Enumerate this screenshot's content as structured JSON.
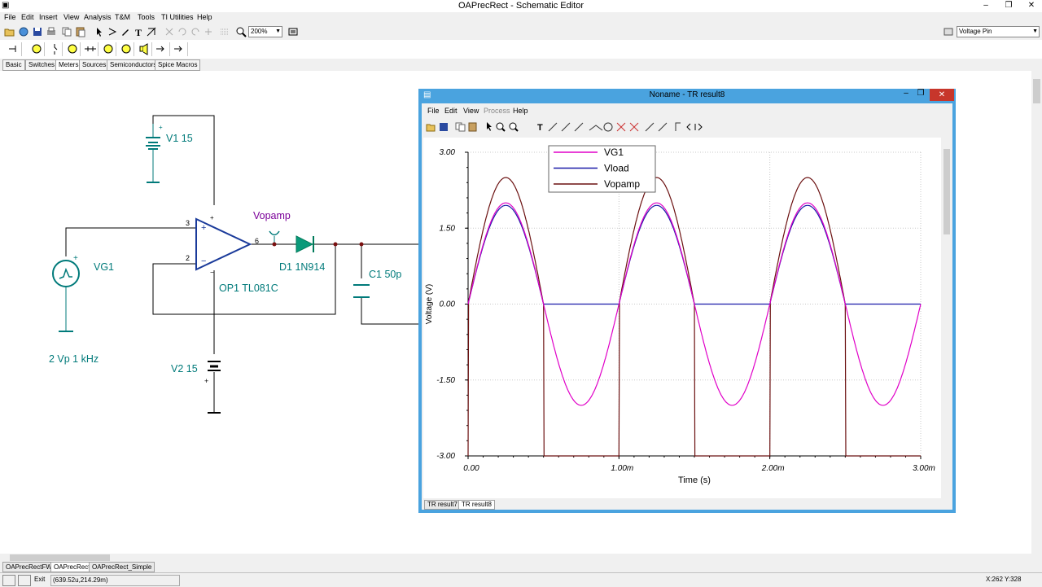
{
  "app": {
    "title": "OAPrecRect - Schematic Editor",
    "menu": [
      "File",
      "Edit",
      "Insert",
      "View",
      "Analysis",
      "T&M",
      "Tools",
      "TI Utilities",
      "Help"
    ],
    "zoom": "200%",
    "voltage_pin_select": "Voltage Pin",
    "component_tabs": [
      "Basic",
      "Switches",
      "Meters",
      "Sources",
      "Semiconductors",
      "Spice Macros"
    ],
    "doc_tabs": [
      "OAPrecRectFW",
      "OAPrecRect",
      "OAPrecRect_Simple"
    ],
    "status_exit": "Exit",
    "status_coords": "(639.52u,214.29m)",
    "status_xy": "X:262  Y:328",
    "toolbar_icons": [
      "open-icon",
      "save-icon",
      "print-icon",
      "copy-icon",
      "paste-icon",
      "pointer-icon",
      "wire-icon",
      "text-icon",
      "zoom-icon"
    ]
  },
  "schematic": {
    "v1_label": "V1 15",
    "v2_label": "V2 15",
    "vg1_label": "VG1",
    "vg1_value": "2 Vp 1 kHz",
    "vopamp_label": "Vopamp",
    "d1_label": "D1 1N914",
    "c1_label": "C1 50p",
    "op1_label": "OP1 TL081C",
    "pin3": "3",
    "pin2": "2",
    "pin6": "6"
  },
  "result_window": {
    "title": "Noname - TR result8",
    "menu": [
      "File",
      "Edit",
      "View",
      "Process",
      "Help"
    ],
    "tabs": [
      "TR result7",
      "TR result8"
    ],
    "active_tab": "TR result8"
  },
  "chart_data": {
    "type": "line",
    "xlabel": "Time (s)",
    "ylabel": "Voltage (V)",
    "xlim": [
      0,
      0.003
    ],
    "ylim": [
      -3,
      3
    ],
    "x_ticks": [
      "0.00",
      "1.00m",
      "2.00m",
      "3.00m"
    ],
    "y_ticks": [
      "3.00",
      "1.50",
      "0.00",
      "-1.50",
      "-3.00"
    ],
    "grid": true,
    "legend_position": "top-center",
    "series": [
      {
        "name": "VG1",
        "color": "#e000c8",
        "kind": "sine",
        "amplitude": 2,
        "freq_hz": 1000
      },
      {
        "name": "Vload",
        "color": "#1a1aa8",
        "kind": "halfwave",
        "amplitude": 1.95,
        "freq_hz": 1000
      },
      {
        "name": "Vopamp",
        "color": "#6b1010",
        "kind": "halfwave_opamp",
        "amplitude": 2.5,
        "low_rail": -3,
        "freq_hz": 1000
      }
    ]
  }
}
